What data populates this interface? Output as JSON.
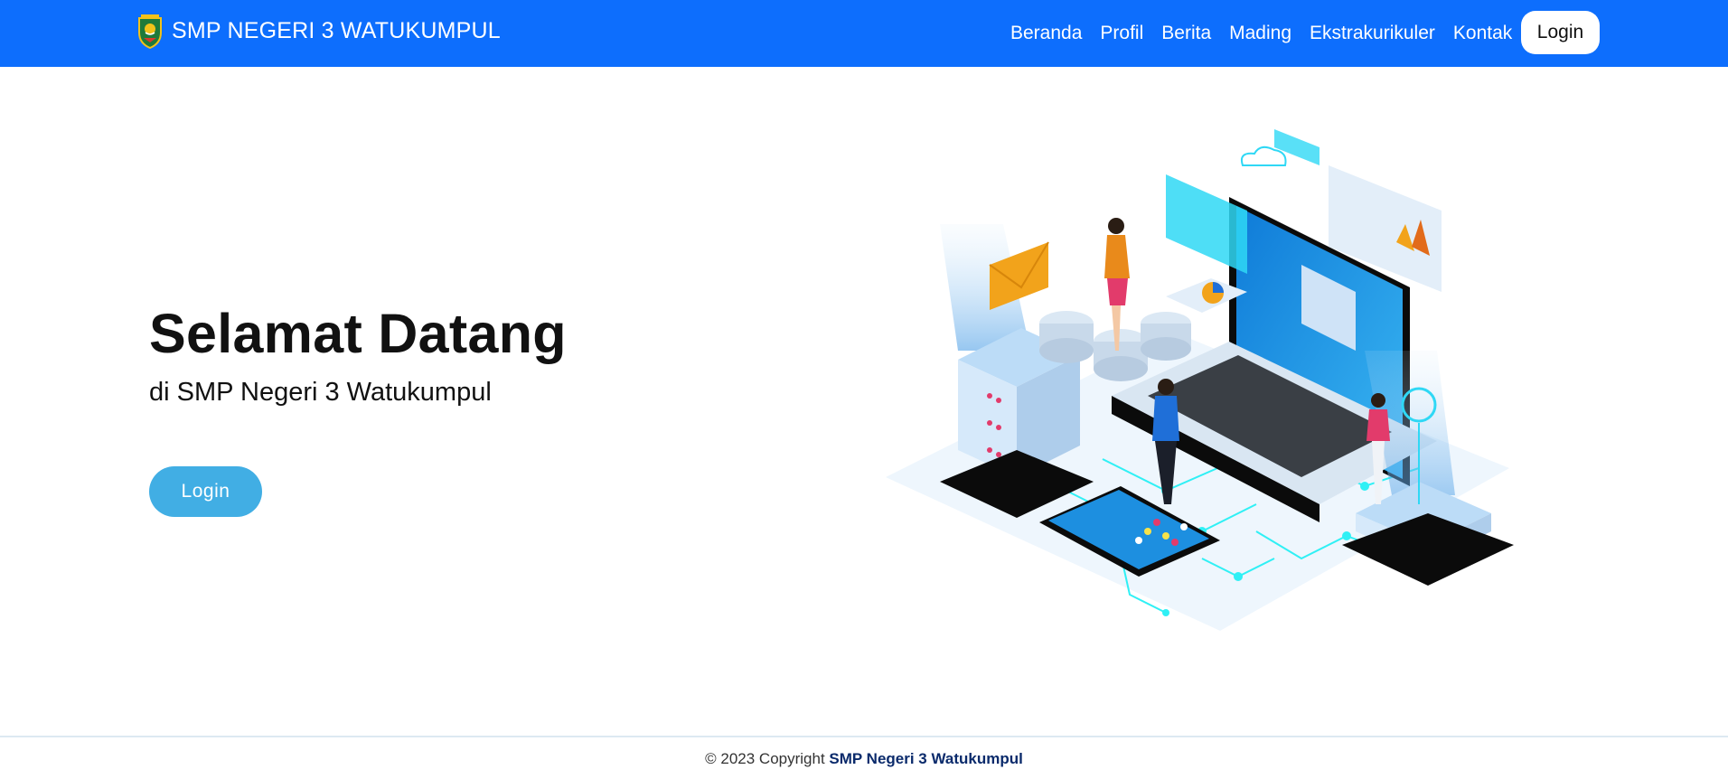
{
  "header": {
    "brand": "SMP NEGERI 3 WATUKUMPUL",
    "nav": [
      "Beranda",
      "Profil",
      "Berita",
      "Mading",
      "Ekstrakurikuler",
      "Kontak"
    ],
    "login_label": "Login"
  },
  "hero": {
    "title": "Selamat Datang",
    "subtitle": "di SMP Negeri 3 Watukumpul",
    "login_label": "Login"
  },
  "footer": {
    "prefix": "© 2023 Copyright",
    "name": "SMP Negeri 3 Watukumpul"
  },
  "colors": {
    "navbar": "#0d6efd",
    "hero_button": "#41aee4",
    "footer_name": "#0a2a6b",
    "accent_cyan": "#2ff0f5"
  },
  "icons": [
    "school-logo-icon"
  ]
}
